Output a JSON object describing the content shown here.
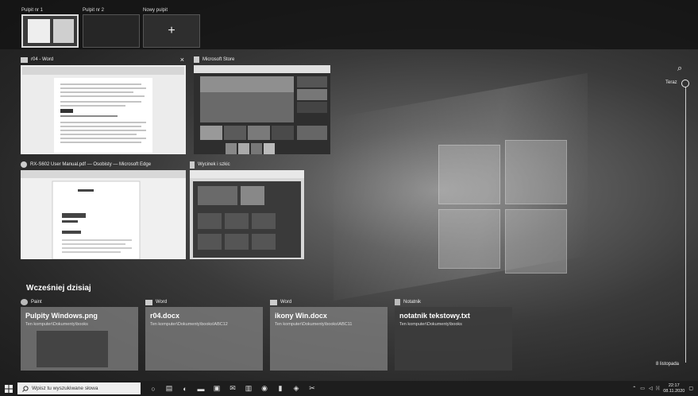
{
  "desktops": [
    {
      "label": "Pulpit nr 1",
      "active": true
    },
    {
      "label": "Pulpit nr 2",
      "active": false
    }
  ],
  "new_desktop": {
    "label": "Nowy pulpit",
    "plus": "+"
  },
  "windows": [
    {
      "title": "r04 - Word",
      "icon": "word-icon"
    },
    {
      "title": "Microsoft Store",
      "icon": "store-icon"
    },
    {
      "title": "RX-S602 User Manual.pdf — Osobisty — Microsoft Edge",
      "icon": "edge-icon"
    },
    {
      "title": "Wycinek i szkic",
      "icon": "snip-icon"
    }
  ],
  "close_glyph": "×",
  "timeline": {
    "search_glyph": "⌕",
    "now_label": "Teraz",
    "date_label": "8 listopada",
    "section_heading": "Wcześniej dzisiaj"
  },
  "activities": [
    {
      "app": "Paint",
      "name": "Pulpity Windows.png",
      "path": "Ten komputer\\Dokumenty\\books"
    },
    {
      "app": "Word",
      "name": "r04.docx",
      "path": "Ten komputer\\Dokumenty\\books\\ABC12"
    },
    {
      "app": "Word",
      "name": "ikony Win.docx",
      "path": "Ten komputer\\Dokumenty\\books\\ABC11"
    },
    {
      "app": "Notatnik",
      "name": "notatnik tekstowy.txt",
      "path": "Ten komputer\\Dokumenty\\books"
    }
  ],
  "taskbar": {
    "search_placeholder": "Wpisz tu wyszukiwane słowa",
    "time": "22:17",
    "date": "08.11.2020"
  }
}
